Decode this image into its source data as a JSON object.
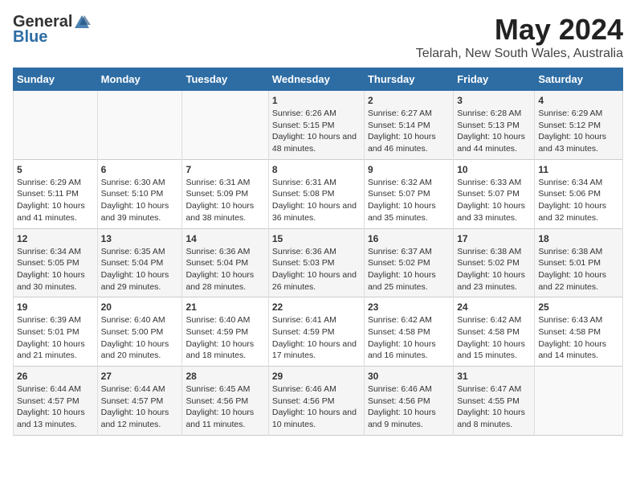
{
  "logo": {
    "general": "General",
    "blue": "Blue"
  },
  "title": "May 2024",
  "subtitle": "Telarah, New South Wales, Australia",
  "days_of_week": [
    "Sunday",
    "Monday",
    "Tuesday",
    "Wednesday",
    "Thursday",
    "Friday",
    "Saturday"
  ],
  "weeks": [
    [
      {
        "day": "",
        "details": ""
      },
      {
        "day": "",
        "details": ""
      },
      {
        "day": "",
        "details": ""
      },
      {
        "day": "1",
        "details": "Sunrise: 6:26 AM\nSunset: 5:15 PM\nDaylight: 10 hours and 48 minutes."
      },
      {
        "day": "2",
        "details": "Sunrise: 6:27 AM\nSunset: 5:14 PM\nDaylight: 10 hours and 46 minutes."
      },
      {
        "day": "3",
        "details": "Sunrise: 6:28 AM\nSunset: 5:13 PM\nDaylight: 10 hours and 44 minutes."
      },
      {
        "day": "4",
        "details": "Sunrise: 6:29 AM\nSunset: 5:12 PM\nDaylight: 10 hours and 43 minutes."
      }
    ],
    [
      {
        "day": "5",
        "details": "Sunrise: 6:29 AM\nSunset: 5:11 PM\nDaylight: 10 hours and 41 minutes."
      },
      {
        "day": "6",
        "details": "Sunrise: 6:30 AM\nSunset: 5:10 PM\nDaylight: 10 hours and 39 minutes."
      },
      {
        "day": "7",
        "details": "Sunrise: 6:31 AM\nSunset: 5:09 PM\nDaylight: 10 hours and 38 minutes."
      },
      {
        "day": "8",
        "details": "Sunrise: 6:31 AM\nSunset: 5:08 PM\nDaylight: 10 hours and 36 minutes."
      },
      {
        "day": "9",
        "details": "Sunrise: 6:32 AM\nSunset: 5:07 PM\nDaylight: 10 hours and 35 minutes."
      },
      {
        "day": "10",
        "details": "Sunrise: 6:33 AM\nSunset: 5:07 PM\nDaylight: 10 hours and 33 minutes."
      },
      {
        "day": "11",
        "details": "Sunrise: 6:34 AM\nSunset: 5:06 PM\nDaylight: 10 hours and 32 minutes."
      }
    ],
    [
      {
        "day": "12",
        "details": "Sunrise: 6:34 AM\nSunset: 5:05 PM\nDaylight: 10 hours and 30 minutes."
      },
      {
        "day": "13",
        "details": "Sunrise: 6:35 AM\nSunset: 5:04 PM\nDaylight: 10 hours and 29 minutes."
      },
      {
        "day": "14",
        "details": "Sunrise: 6:36 AM\nSunset: 5:04 PM\nDaylight: 10 hours and 28 minutes."
      },
      {
        "day": "15",
        "details": "Sunrise: 6:36 AM\nSunset: 5:03 PM\nDaylight: 10 hours and 26 minutes."
      },
      {
        "day": "16",
        "details": "Sunrise: 6:37 AM\nSunset: 5:02 PM\nDaylight: 10 hours and 25 minutes."
      },
      {
        "day": "17",
        "details": "Sunrise: 6:38 AM\nSunset: 5:02 PM\nDaylight: 10 hours and 23 minutes."
      },
      {
        "day": "18",
        "details": "Sunrise: 6:38 AM\nSunset: 5:01 PM\nDaylight: 10 hours and 22 minutes."
      }
    ],
    [
      {
        "day": "19",
        "details": "Sunrise: 6:39 AM\nSunset: 5:01 PM\nDaylight: 10 hours and 21 minutes."
      },
      {
        "day": "20",
        "details": "Sunrise: 6:40 AM\nSunset: 5:00 PM\nDaylight: 10 hours and 20 minutes."
      },
      {
        "day": "21",
        "details": "Sunrise: 6:40 AM\nSunset: 4:59 PM\nDaylight: 10 hours and 18 minutes."
      },
      {
        "day": "22",
        "details": "Sunrise: 6:41 AM\nSunset: 4:59 PM\nDaylight: 10 hours and 17 minutes."
      },
      {
        "day": "23",
        "details": "Sunrise: 6:42 AM\nSunset: 4:58 PM\nDaylight: 10 hours and 16 minutes."
      },
      {
        "day": "24",
        "details": "Sunrise: 6:42 AM\nSunset: 4:58 PM\nDaylight: 10 hours and 15 minutes."
      },
      {
        "day": "25",
        "details": "Sunrise: 6:43 AM\nSunset: 4:58 PM\nDaylight: 10 hours and 14 minutes."
      }
    ],
    [
      {
        "day": "26",
        "details": "Sunrise: 6:44 AM\nSunset: 4:57 PM\nDaylight: 10 hours and 13 minutes."
      },
      {
        "day": "27",
        "details": "Sunrise: 6:44 AM\nSunset: 4:57 PM\nDaylight: 10 hours and 12 minutes."
      },
      {
        "day": "28",
        "details": "Sunrise: 6:45 AM\nSunset: 4:56 PM\nDaylight: 10 hours and 11 minutes."
      },
      {
        "day": "29",
        "details": "Sunrise: 6:46 AM\nSunset: 4:56 PM\nDaylight: 10 hours and 10 minutes."
      },
      {
        "day": "30",
        "details": "Sunrise: 6:46 AM\nSunset: 4:56 PM\nDaylight: 10 hours and 9 minutes."
      },
      {
        "day": "31",
        "details": "Sunrise: 6:47 AM\nSunset: 4:55 PM\nDaylight: 10 hours and 8 minutes."
      },
      {
        "day": "",
        "details": ""
      }
    ]
  ]
}
